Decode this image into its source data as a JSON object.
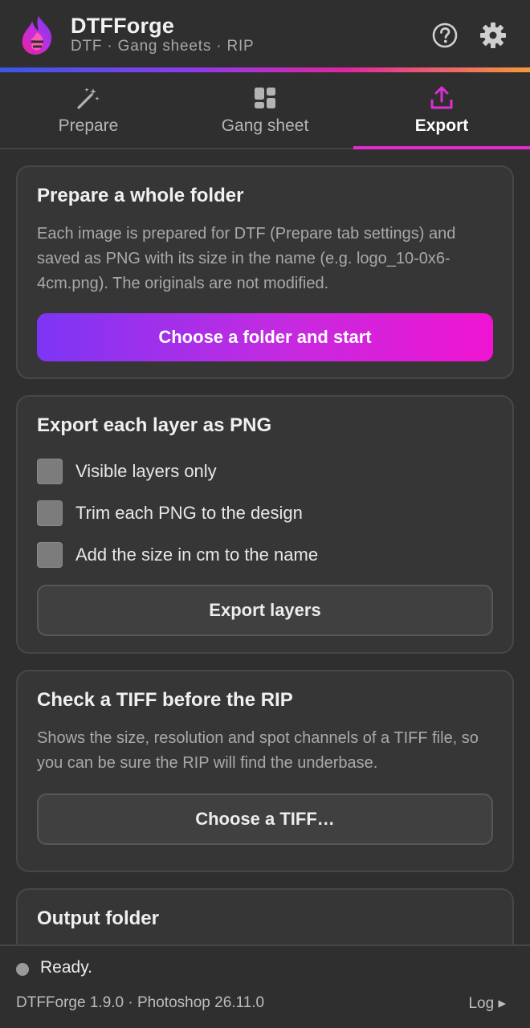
{
  "header": {
    "title": "DTFForge",
    "subtitle": "DTF · Gang sheets · RIP",
    "icons": [
      "help-icon",
      "gear-icon"
    ],
    "gradient_colors": [
      "#3a57e8",
      "#8a3cf0",
      "#e0269e",
      "#f49a3a"
    ]
  },
  "tabs": [
    {
      "label": "Prepare",
      "icon": "magic-wand-icon",
      "active": false
    },
    {
      "label": "Gang sheet",
      "icon": "grid-layout-icon",
      "active": false
    },
    {
      "label": "Export",
      "icon": "upload-tray-icon",
      "active": true
    }
  ],
  "accent_color": "#e52bd0",
  "cards": {
    "folder": {
      "title": "Prepare a whole folder",
      "description": "Each image is prepared for DTF (Prepare tab settings) and saved as PNG with its size in the name (e.g. logo_10-0x6-4cm.png). The originals are not modified.",
      "button": "Choose a folder and start"
    },
    "layers": {
      "title": "Export each layer as PNG",
      "options": [
        {
          "label": "Visible layers only",
          "checked": false
        },
        {
          "label": "Trim each PNG to the design",
          "checked": false
        },
        {
          "label": "Add the size in cm to the name",
          "checked": false
        }
      ],
      "button": "Export layers"
    },
    "tiff": {
      "title": "Check a TIFF before the RIP",
      "description": "Shows the size, resolution and spot channels of a TIFF file, so you can be sure the RIP will find the underbase.",
      "button": "Choose a TIFF…"
    },
    "output": {
      "title": "Output folder"
    }
  },
  "footer": {
    "status": "Ready.",
    "version": "DTFForge 1.9.0 · Photoshop 26.11.0",
    "log_link": "Log ▸"
  }
}
